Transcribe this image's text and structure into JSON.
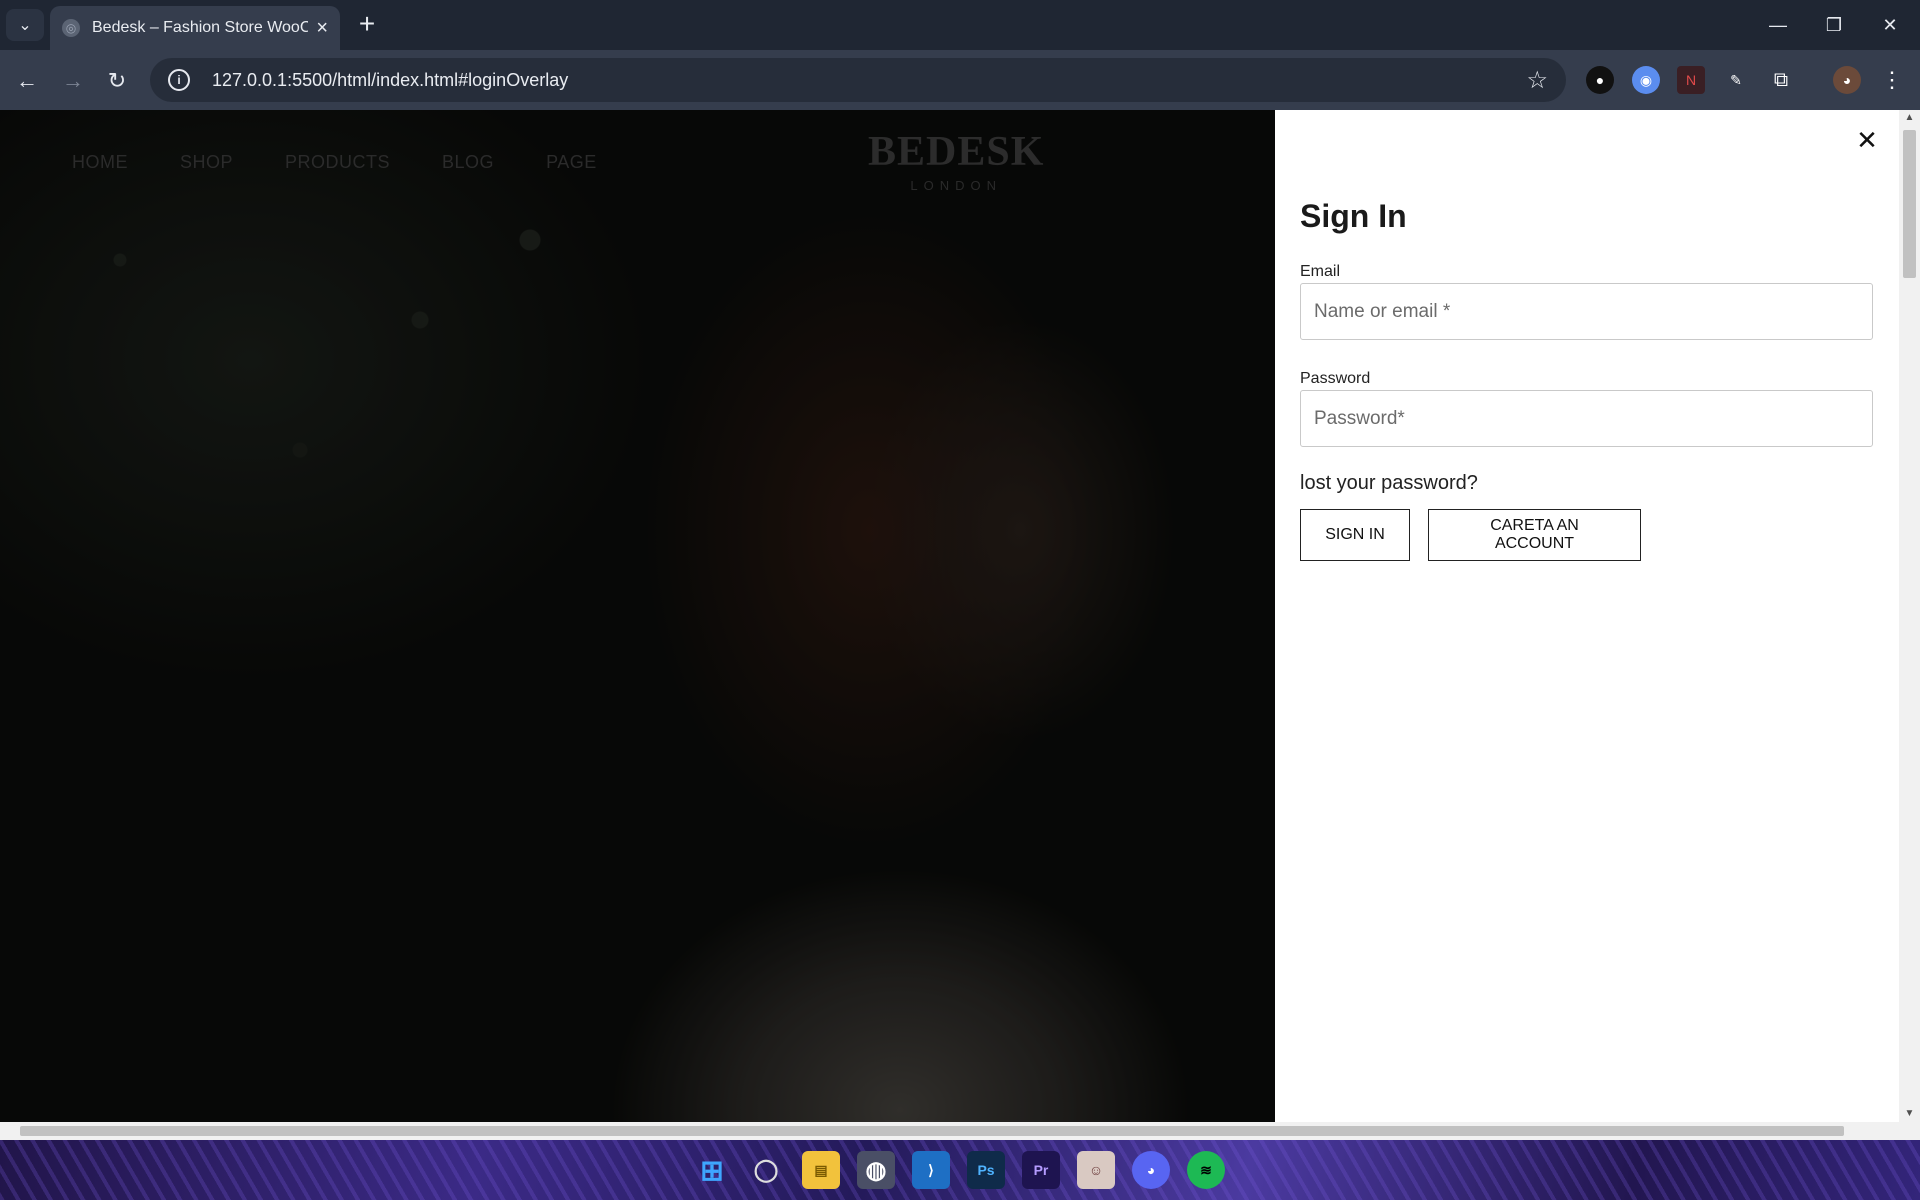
{
  "browser": {
    "tab_title": "Bedesk – Fashion Store WooCommerce Theme",
    "url": "127.0.0.1:5500/html/index.html#loginOverlay"
  },
  "site": {
    "nav": [
      "HOME",
      "SHOP",
      "PRODUCTS",
      "BLOG",
      "PAGE"
    ],
    "brand_name": "BEDESK",
    "brand_sub": "LONDON"
  },
  "login": {
    "title": "Sign In",
    "email_label": "Email",
    "email_placeholder": "Name or email *",
    "password_label": "Password",
    "password_placeholder": "Password*",
    "lost_password": "lost your password?",
    "sign_in_button": "SIGN IN",
    "create_account_button": "CARETA AN ACCOUNT"
  },
  "taskbar": {
    "apps": [
      "windows-start",
      "search",
      "file-explorer",
      "chrome",
      "vscode",
      "photoshop",
      "premiere-pro",
      "app",
      "discord",
      "spotify"
    ]
  }
}
